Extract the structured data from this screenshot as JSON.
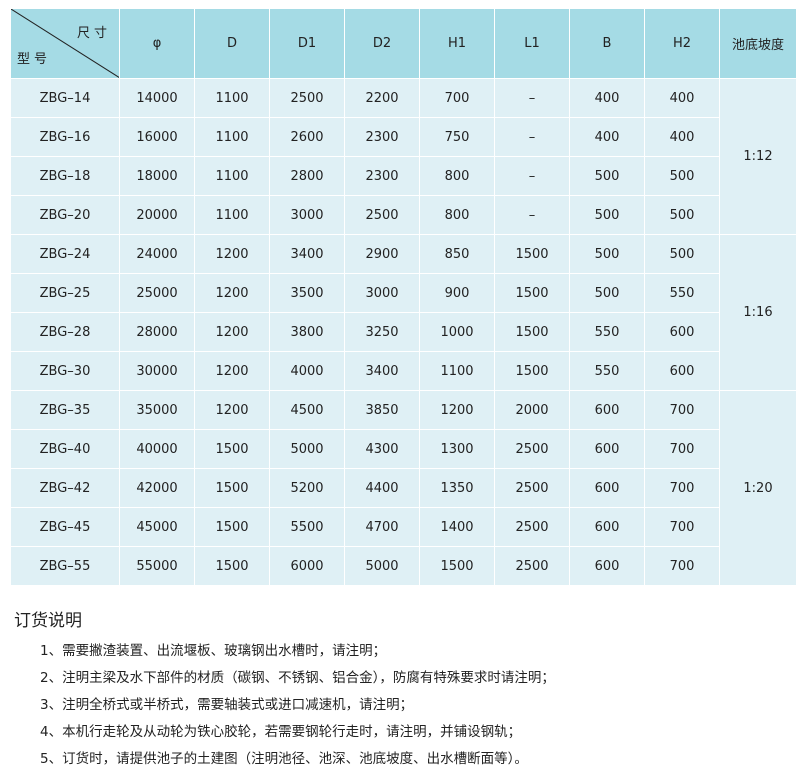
{
  "table": {
    "header": {
      "dimension_label": "尺寸",
      "model_label": "型号",
      "columns": [
        "φ",
        "D",
        "D1",
        "D2",
        "H1",
        "L1",
        "B",
        "H2",
        "池底坡度"
      ]
    },
    "rows": [
      {
        "model": "ZBG–14",
        "values": [
          "14000",
          "1100",
          "2500",
          "2200",
          "700",
          "–",
          "400",
          "400"
        ]
      },
      {
        "model": "ZBG–16",
        "values": [
          "16000",
          "1100",
          "2600",
          "2300",
          "750",
          "–",
          "400",
          "400"
        ]
      },
      {
        "model": "ZBG–18",
        "values": [
          "18000",
          "1100",
          "2800",
          "2300",
          "800",
          "–",
          "500",
          "500"
        ]
      },
      {
        "model": "ZBG–20",
        "values": [
          "20000",
          "1100",
          "3000",
          "2500",
          "800",
          "–",
          "500",
          "500"
        ]
      },
      {
        "model": "ZBG–24",
        "values": [
          "24000",
          "1200",
          "3400",
          "2900",
          "850",
          "1500",
          "500",
          "500"
        ]
      },
      {
        "model": "ZBG–25",
        "values": [
          "25000",
          "1200",
          "3500",
          "3000",
          "900",
          "1500",
          "500",
          "550"
        ]
      },
      {
        "model": "ZBG–28",
        "values": [
          "28000",
          "1200",
          "3800",
          "3250",
          "1000",
          "1500",
          "550",
          "600"
        ]
      },
      {
        "model": "ZBG–30",
        "values": [
          "30000",
          "1200",
          "4000",
          "3400",
          "1100",
          "1500",
          "550",
          "600"
        ]
      },
      {
        "model": "ZBG–35",
        "values": [
          "35000",
          "1200",
          "4500",
          "3850",
          "1200",
          "2000",
          "600",
          "700"
        ]
      },
      {
        "model": "ZBG–40",
        "values": [
          "40000",
          "1500",
          "5000",
          "4300",
          "1300",
          "2500",
          "600",
          "700"
        ]
      },
      {
        "model": "ZBG–42",
        "values": [
          "42000",
          "1500",
          "5200",
          "4400",
          "1350",
          "2500",
          "600",
          "700"
        ]
      },
      {
        "model": "ZBG–45",
        "values": [
          "45000",
          "1500",
          "5500",
          "4700",
          "1400",
          "2500",
          "600",
          "700"
        ]
      },
      {
        "model": "ZBG–55",
        "values": [
          "55000",
          "1500",
          "6000",
          "5000",
          "1500",
          "2500",
          "600",
          "700"
        ]
      }
    ],
    "slope_groups": [
      {
        "value": "1:12",
        "rows": 4
      },
      {
        "value": "1:16",
        "rows": 4
      },
      {
        "value": "1:20",
        "rows": 5
      }
    ]
  },
  "notes": {
    "title": "订货说明",
    "items": [
      "1、需要撇渣装置、出流堰板、玻璃钢出水槽时，请注明；",
      "2、注明主梁及水下部件的材质（碳钢、不锈钢、铝合金），防腐有特殊要求时请注明；",
      "3、注明全桥式或半桥式，需要轴装式或进口减速机，请注明；",
      "4、本机行走轮及从动轮为铁心胶轮，若需要钢轮行走时，请注明，并铺设钢轨；",
      "5、订货时，请提供池子的土建图（注明池径、池深、池底坡度、出水槽断面等）。"
    ]
  },
  "colors": {
    "header_bg": "#a5dbe5",
    "body_bg": "#dff0f5"
  }
}
